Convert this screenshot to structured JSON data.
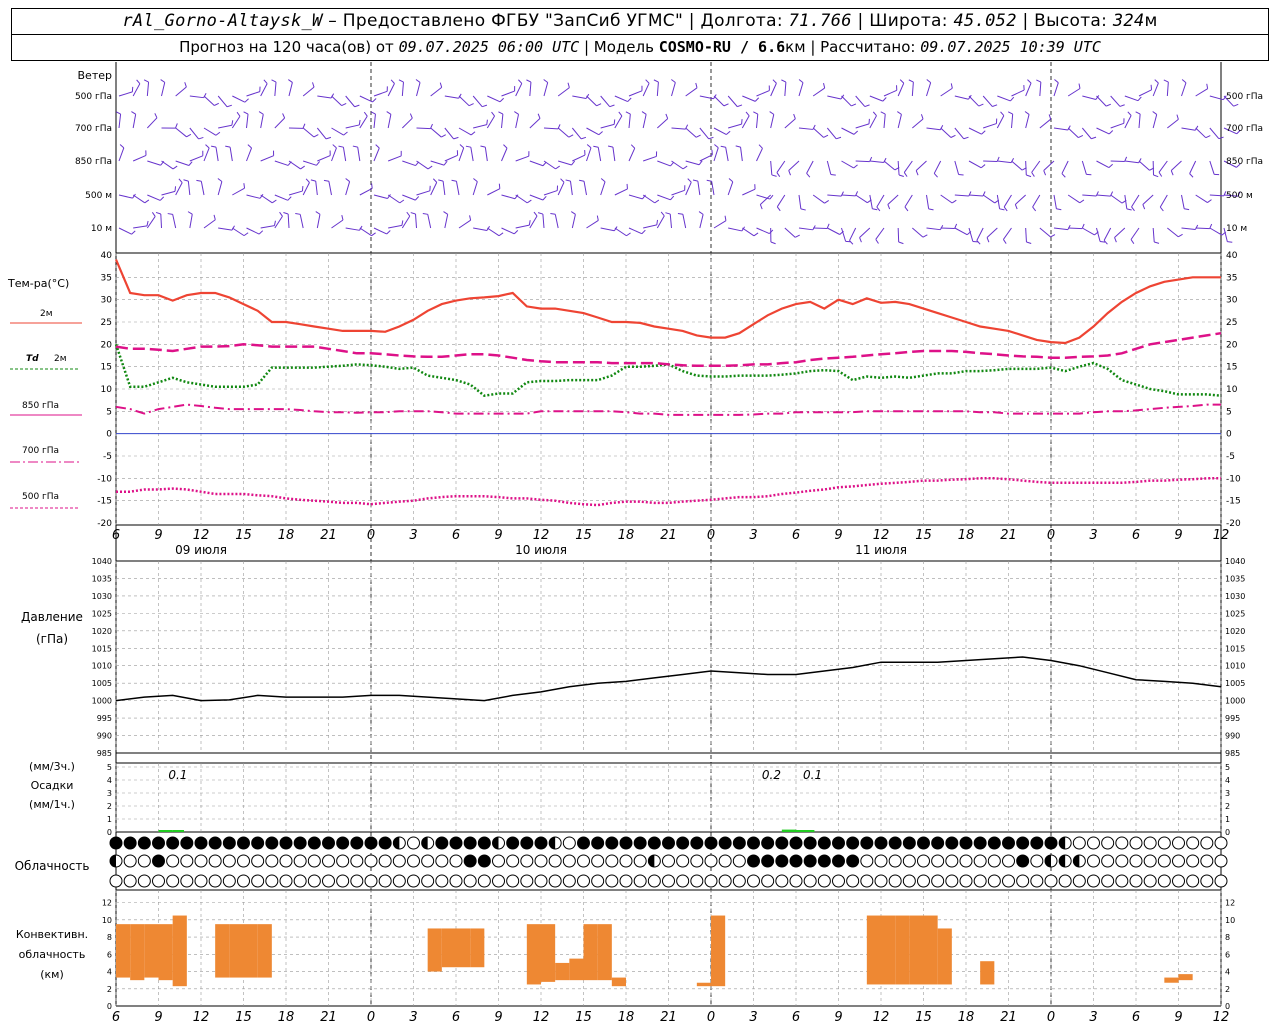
{
  "header": {
    "station": "rAl_Gorno-Altaysk_W",
    "provider_text": "– Предоставлено ФГБУ \"ЗапСиб УГМС\"",
    "lon_label": "Долгота:",
    "lon_value": "71.766",
    "lat_label": "Широта:",
    "lat_value": "45.052",
    "alt_label": "Высота:",
    "alt_value": "324",
    "alt_unit": "м",
    "forecast_text": "Прогноз на 120 часа(ов) от",
    "forecast_start": "09.07.2025 06:00 UTC",
    "model_label": "Модель",
    "model_name": "COSMO-RU / 6.6",
    "model_unit": "км",
    "calc_label": "Рассчитано:",
    "calc_time": "09.07.2025 10:39 UTC"
  },
  "time_axis": {
    "hour_labels": [
      "6",
      "9",
      "12",
      "15",
      "18",
      "21",
      "0",
      "3",
      "6",
      "9",
      "12",
      "15",
      "18",
      "21",
      "0",
      "3",
      "6",
      "9",
      "12",
      "15",
      "18",
      "21",
      "0",
      "3",
      "6",
      "9",
      "12"
    ],
    "day_labels": [
      {
        "text": "09 июля",
        "at_hour": 12
      },
      {
        "text": "10 июля",
        "at_hour": 36
      },
      {
        "text": "11 июля",
        "at_hour": 60
      }
    ],
    "midnight_hours": [
      18,
      42,
      66
    ],
    "start_hour": 6,
    "hours_total": 78
  },
  "labels": {
    "wind": "Ветер",
    "wind_levels": [
      "500 гПа",
      "700 гПа",
      "850 гПа",
      "500  м",
      "10   м"
    ],
    "temp_title": "Тем-ра(°С)",
    "t2m": "2м",
    "td": "Td",
    "td_level": "2м",
    "l850": "850 гПа",
    "l700": "700 гПа",
    "l500": "500 гПа",
    "pressure_title": "Давление",
    "pressure_unit": "(гПа)",
    "precip_unit3": "(мм/3ч.)",
    "precip_title": "Осадки",
    "precip_unit1": "(мм/1ч.)",
    "cloud_title": "Облачность",
    "conv_title1": "Конвективн.",
    "conv_title2": "облачность",
    "conv_unit": "(км)"
  },
  "colors": {
    "t2m": "#ee4433",
    "td": "#118811",
    "upper": "#dd1188",
    "zero_line": "#3344cc",
    "wind": "#6633cc",
    "precip": "#22cc22",
    "conv": "#ee8833"
  },
  "chart_data": [
    {
      "type": "line",
      "name_ru": "Температура",
      "x_hours": [
        6,
        7,
        8,
        9,
        10,
        11,
        12,
        13,
        14,
        15,
        16,
        17,
        18,
        19,
        20,
        21,
        22,
        23,
        24,
        25,
        26,
        27,
        28,
        29,
        30,
        31,
        32,
        33,
        34,
        35,
        36,
        37,
        38,
        39,
        40,
        41,
        42,
        43,
        44,
        45,
        46,
        47,
        48,
        49,
        50,
        51,
        52,
        53,
        54,
        55,
        56,
        57,
        58,
        59,
        60,
        61,
        62,
        63,
        64,
        65,
        66,
        67,
        68,
        69,
        70,
        71,
        72,
        73,
        74,
        75,
        76,
        77,
        78,
        79,
        80,
        81,
        82,
        83,
        84
      ],
      "ylim": [
        -20,
        40
      ],
      "series": [
        {
          "name": "2м",
          "style": "solid",
          "values": [
            39,
            31.5,
            31,
            31,
            29.8,
            31,
            31.5,
            31.5,
            30.5,
            29,
            27.5,
            25,
            25,
            24.5,
            24,
            23.5,
            23,
            23,
            23,
            22.8,
            24,
            25.5,
            27.5,
            29,
            29.8,
            30.3,
            30.5,
            30.8,
            31.5,
            28.5,
            28,
            28,
            27.5,
            27,
            26,
            25,
            25,
            24.8,
            24,
            23.5,
            23,
            22,
            21.5,
            21.5,
            22.5,
            24.5,
            26.5,
            28,
            29,
            29.5,
            28,
            30,
            29,
            30.3,
            29.3,
            29.5,
            29,
            28,
            27,
            26,
            25,
            24,
            23.5,
            23,
            22,
            21,
            20.5,
            20.3,
            21.5,
            24,
            27,
            29.5,
            31.5,
            33,
            34,
            34.5,
            35,
            35,
            35
          ]
        },
        {
          "name": "Td 2м",
          "style": "dotted",
          "values": [
            20,
            10.5,
            10.5,
            11.5,
            12.5,
            11.5,
            11,
            10.5,
            10.5,
            10.5,
            11,
            14.8,
            14.8,
            14.8,
            14.8,
            15,
            15.2,
            15.5,
            15.3,
            15,
            14.5,
            14.8,
            13,
            12.5,
            12,
            11,
            8.5,
            9,
            9,
            11.5,
            11.8,
            11.8,
            12,
            12,
            12,
            13,
            15,
            15,
            15.2,
            15.5,
            14,
            13,
            12.8,
            12.8,
            13,
            13,
            13,
            13.2,
            13.5,
            14,
            14.2,
            14,
            12,
            12.8,
            12.5,
            12.8,
            12.5,
            13,
            13.5,
            13.5,
            14,
            14,
            14.2,
            14.5,
            14.5,
            14.5,
            14.8,
            14,
            15,
            15.8,
            14.5,
            12,
            11,
            10,
            9.5,
            8.8,
            8.8,
            8.8,
            8.5
          ]
        },
        {
          "name": "850 гПа",
          "style": "longdash",
          "values": [
            19.5,
            19,
            19,
            18.8,
            18.5,
            19,
            19.5,
            19.5,
            19.6,
            20,
            19.8,
            19.5,
            19.5,
            19.5,
            19.5,
            19,
            18.5,
            18,
            18,
            17.8,
            17.5,
            17.3,
            17.2,
            17.2,
            17.5,
            17.8,
            17.8,
            17.5,
            17,
            16.5,
            16.2,
            16,
            16,
            16,
            16,
            15.8,
            15.8,
            15.8,
            15.8,
            15.5,
            15.3,
            15.2,
            15.2,
            15.2,
            15.3,
            15.5,
            15.5,
            15.8,
            16,
            16.5,
            16.8,
            17,
            17.2,
            17.5,
            17.8,
            18,
            18.3,
            18.5,
            18.5,
            18.5,
            18.3,
            18,
            17.8,
            17.5,
            17.3,
            17.2,
            17,
            17,
            17.2,
            17.3,
            17.5,
            18,
            19,
            20,
            20.5,
            21,
            21.5,
            22,
            22.5
          ]
        },
        {
          "name": "700 гПа",
          "style": "dashdot",
          "values": [
            6,
            5.5,
            4.5,
            5.5,
            6,
            6.5,
            6.2,
            5.8,
            5.5,
            5.5,
            5.5,
            5.5,
            5.5,
            5.3,
            5,
            4.8,
            4.8,
            4.7,
            4.8,
            4.8,
            5,
            5,
            5,
            4.8,
            4.5,
            4.5,
            4.5,
            4.5,
            4.5,
            4.5,
            5,
            5,
            5,
            5,
            5,
            5,
            4.8,
            4.5,
            4.5,
            4.2,
            4.2,
            4.2,
            4.2,
            4.2,
            4.2,
            4.3,
            4.5,
            4.5,
            4.8,
            4.8,
            4.8,
            4.8,
            4.8,
            5,
            5,
            5,
            5,
            5,
            5,
            5,
            5,
            4.8,
            4.8,
            4.5,
            4.5,
            4.5,
            4.5,
            4.5,
            4.5,
            4.8,
            5,
            5,
            5.2,
            5.5,
            5.8,
            6,
            6.2,
            6.5,
            6.5
          ]
        },
        {
          "name": "500 гПа",
          "style": "dense",
          "values": [
            -13,
            -13,
            -12.5,
            -12.5,
            -12.3,
            -12.5,
            -13,
            -13.5,
            -13.5,
            -13.5,
            -13.8,
            -14,
            -14.5,
            -14.8,
            -15,
            -15.2,
            -15.5,
            -15.5,
            -15.8,
            -15.5,
            -15.2,
            -15,
            -14.5,
            -14.2,
            -14,
            -14,
            -14,
            -14.2,
            -14.5,
            -14.5,
            -14.8,
            -15,
            -15.5,
            -15.8,
            -16,
            -15.5,
            -15.2,
            -15.2,
            -15.5,
            -15.5,
            -15.2,
            -15,
            -14.8,
            -14.5,
            -14.2,
            -14.2,
            -14,
            -13.5,
            -13.2,
            -12.8,
            -12.5,
            -12,
            -11.8,
            -11.5,
            -11.2,
            -11,
            -10.8,
            -10.5,
            -10.5,
            -10.3,
            -10.2,
            -10,
            -10,
            -10.2,
            -10.5,
            -10.8,
            -11,
            -11,
            -11,
            -11,
            -11,
            -11,
            -10.8,
            -10.5,
            -10.5,
            -10.3,
            -10.2,
            -10,
            -10
          ]
        }
      ]
    },
    {
      "type": "line",
      "name_ru": "Давление",
      "x_hours": [
        6,
        8,
        10,
        12,
        14,
        16,
        18,
        20,
        22,
        24,
        26,
        28,
        30,
        32,
        34,
        36,
        38,
        40,
        42,
        44,
        46,
        48,
        50,
        52,
        54,
        56,
        58,
        60,
        62,
        64,
        66,
        68,
        70,
        72,
        74,
        76,
        78,
        80,
        82,
        84
      ],
      "ylim": [
        985,
        1040
      ],
      "y_ticks": [
        985,
        990,
        995,
        1000,
        1005,
        1010,
        1015,
        1020,
        1025,
        1030,
        1035,
        1040
      ],
      "series": [
        {
          "name": "Давление",
          "values": [
            1000,
            1001,
            1001.5,
            1000,
            1000.2,
            1001.5,
            1001,
            1001,
            1001,
            1001.5,
            1001.5,
            1001,
            1000.5,
            1000,
            1001.5,
            1002.5,
            1004,
            1005,
            1005.5,
            1006.5,
            1007.5,
            1008.5,
            1008,
            1007.5,
            1007.5,
            1008.5,
            1009.5,
            1011,
            1011,
            1011,
            1011.5,
            1012,
            1012.5,
            1011.5,
            1010,
            1008,
            1006,
            1005.5,
            1005,
            1004
          ]
        }
      ]
    },
    {
      "type": "bar",
      "name_ru": "Осадки",
      "ylim": [
        0,
        5
      ],
      "y_ticks": [
        0,
        1,
        2,
        3,
        4,
        5
      ],
      "bars": [
        {
          "hour": 9,
          "width_h": 1,
          "value": 0.1
        },
        {
          "hour": 10,
          "width_h": 0.8,
          "value": 0.1
        },
        {
          "hour": 53,
          "width_h": 1,
          "value": 0.2
        },
        {
          "hour": 54,
          "width_h": 1.3,
          "value": 0.1
        }
      ],
      "annotations": [
        {
          "hour": 10.4,
          "text": "0.1"
        },
        {
          "hour": 52.3,
          "text": "0.2"
        },
        {
          "hour": 55.2,
          "text": "0.1"
        }
      ]
    },
    {
      "type": "bar",
      "name_ru": "Конвективная облачность",
      "ylim": [
        0,
        13
      ],
      "y_ticks": [
        0,
        2,
        4,
        6,
        8,
        10,
        12
      ],
      "bars": [
        {
          "hour": 6.5,
          "top": 9.5,
          "base": 3.3
        },
        {
          "hour": 7.5,
          "top": 9.5,
          "base": 3.0
        },
        {
          "hour": 8.5,
          "top": 9.5,
          "base": 3.3
        },
        {
          "hour": 9.5,
          "top": 9.5,
          "base": 3.0
        },
        {
          "hour": 10.5,
          "top": 10.5,
          "base": 2.3
        },
        {
          "hour": 13.5,
          "top": 9.5,
          "base": 3.3
        },
        {
          "hour": 14.5,
          "top": 9.5,
          "base": 3.3
        },
        {
          "hour": 15.5,
          "top": 9.5,
          "base": 3.3
        },
        {
          "hour": 16.5,
          "top": 9.5,
          "base": 3.3
        },
        {
          "hour": 28.5,
          "top": 9.0,
          "base": 4.0
        },
        {
          "hour": 29.5,
          "top": 9.0,
          "base": 4.5
        },
        {
          "hour": 30.5,
          "top": 9.0,
          "base": 4.5
        },
        {
          "hour": 31.5,
          "top": 9.0,
          "base": 4.5
        },
        {
          "hour": 35.5,
          "top": 9.5,
          "base": 2.5
        },
        {
          "hour": 36.5,
          "top": 9.5,
          "base": 2.8
        },
        {
          "hour": 37.5,
          "top": 5.0,
          "base": 3.0
        },
        {
          "hour": 38.5,
          "top": 5.5,
          "base": 3.0
        },
        {
          "hour": 39.5,
          "top": 9.5,
          "base": 3.0
        },
        {
          "hour": 40.5,
          "top": 9.5,
          "base": 3.0
        },
        {
          "hour": 41.5,
          "top": 3.3,
          "base": 2.3
        },
        {
          "hour": 47.5,
          "top": 2.7,
          "base": 2.3
        },
        {
          "hour": 48.5,
          "top": 10.5,
          "base": 2.3
        },
        {
          "hour": 59.5,
          "top": 10.5,
          "base": 2.5
        },
        {
          "hour": 60.5,
          "top": 10.5,
          "base": 2.5
        },
        {
          "hour": 61.5,
          "top": 10.5,
          "base": 2.5
        },
        {
          "hour": 62.5,
          "top": 10.5,
          "base": 2.5
        },
        {
          "hour": 63.5,
          "top": 10.5,
          "base": 2.5
        },
        {
          "hour": 64.5,
          "top": 9.0,
          "base": 2.5
        },
        {
          "hour": 67.5,
          "top": 5.2,
          "base": 2.5
        },
        {
          "hour": 80.5,
          "top": 3.3,
          "base": 2.7
        },
        {
          "hour": 81.5,
          "top": 3.7,
          "base": 3.0
        }
      ]
    }
  ],
  "cloud_rows": {
    "count_per_row": 79,
    "rows": [
      "FFFFFFFFFFFFFFFFFFFFHOHFFFFHFFFHOFFFFFFFFFFFFFFFFFFFFFFFFFFFFFFFFFFHOOOOOOOOOO",
      "HOOFOOOOOOOOOOOOOOOOOOOOOFFOOOOOOOOOOOHOOOOOOFFFFFFFFOOOOOOOOOOOFOHHHOOOOOOOOOOOOOOOF",
      "OOOOOOOOOOOOOOOOOOOOOOOOOOOOOOOOOOOOOOOOOOOOOOOOOOOOOOOOOOOOOOOOOOOOOOOOOOOOOOO"
    ]
  },
  "wind_rows": 5
}
